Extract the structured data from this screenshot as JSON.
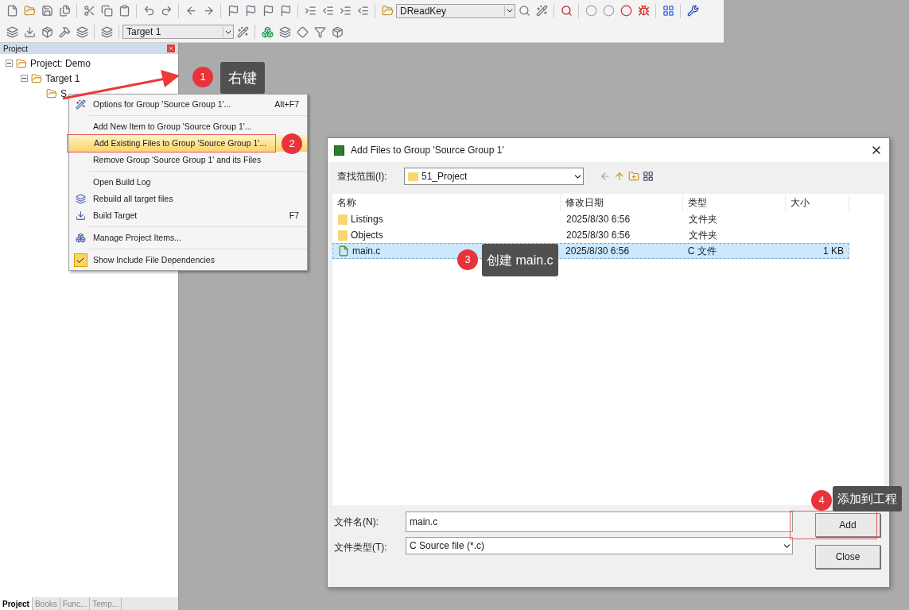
{
  "toolbar": {
    "device_combo": "DReadKey",
    "target_combo": "Target 1"
  },
  "project_panel": {
    "title": "Project",
    "tree": [
      {
        "label": "Project: Demo",
        "expanded": true,
        "children": [
          {
            "label": "Target 1",
            "expanded": true,
            "children": [
              {
                "label": "S"
              }
            ]
          }
        ]
      }
    ],
    "tabs": [
      {
        "label": "Project",
        "selected": true
      },
      {
        "label": "Books",
        "selected": false
      },
      {
        "label": "Func...",
        "selected": false
      },
      {
        "label": "Temp...",
        "selected": false
      }
    ]
  },
  "context_menu": {
    "groups": [
      [
        {
          "label": "Options for Group 'Source Group 1'...",
          "shortcut": "Alt+F7",
          "selected": false
        }
      ],
      [
        {
          "label": "Add New  Item to Group 'Source Group 1'...",
          "selected": false
        },
        {
          "label": "Add Existing Files to Group 'Source Group 1'...",
          "selected": true
        },
        {
          "label": "Remove Group 'Source Group 1' and its Files",
          "selected": false
        }
      ],
      [
        {
          "label": "Open Build Log",
          "selected": false
        },
        {
          "label": "Rebuild all target files",
          "selected": false
        },
        {
          "label": "Build Target",
          "shortcut": "F7",
          "selected": false
        }
      ],
      [
        {
          "label": "Manage Project Items...",
          "selected": false
        }
      ],
      [
        {
          "label": "Show Include File Dependencies",
          "selected": false,
          "checked": true
        }
      ]
    ]
  },
  "dialog": {
    "title": "Add Files to Group 'Source Group 1'",
    "look_in_label": "查找范围(I):",
    "look_in_value": "51_Project",
    "columns": [
      "名称",
      "修改日期",
      "类型",
      "大小"
    ],
    "rows": [
      {
        "kind": "folder",
        "name": "Listings",
        "modified": "2025/8/30 6:56",
        "type": "文件夹",
        "selected": false
      },
      {
        "kind": "folder",
        "name": "Objects",
        "modified": "2025/8/30 6:56",
        "type": "文件夹",
        "selected": false
      },
      {
        "kind": "file",
        "name": "main.c",
        "modified": "2025/8/30 6:56",
        "type": "C 文件",
        "size": "1 KB",
        "selected": true
      }
    ],
    "file_name_label": "文件名(N):",
    "file_name_value": "main.c",
    "file_type_label": "文件类型(T):",
    "file_type_value": "C Source file (*.c)",
    "buttons": [
      "Add",
      "Close"
    ]
  },
  "annotations": [
    {
      "number": "1",
      "text": "右键"
    },
    {
      "number": "2"
    },
    {
      "number": "3",
      "text": "创建 main.c"
    },
    {
      "number": "4",
      "text": "添加到工程"
    }
  ]
}
